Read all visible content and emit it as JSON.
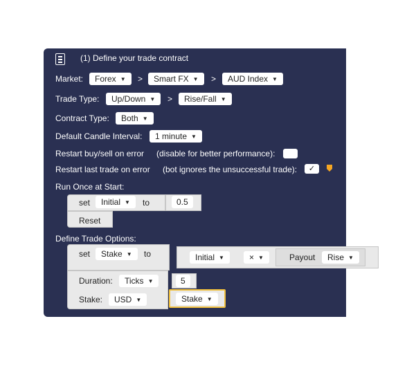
{
  "block": {
    "title": "(1) Define your trade contract",
    "market_label": "Market:",
    "market": "Forex",
    "submarket": "Smart FX",
    "symbol": "AUD Index",
    "sep1": ">",
    "sep2": ">",
    "trade_type_label": "Trade Type:",
    "trade_category": "Up/Down",
    "trade_sep": ">",
    "trade_type": "Rise/Fall",
    "contract_type_label": "Contract Type:",
    "contract_type": "Both",
    "candle_interval_label": "Default Candle Interval:",
    "candle_interval": "1 minute",
    "restart_error_label": "Restart buy/sell on error",
    "restart_error_hint": "(disable for better performance):",
    "restart_error_checked": false,
    "restart_last_label": "Restart last trade on error",
    "restart_last_hint": "(bot ignores the unsuccessful trade):",
    "restart_last_checked": "✓",
    "run_once_label": "Run Once at Start:",
    "trade_options_label": "Define Trade Options:"
  },
  "run_once": {
    "set_label": "set",
    "variable": "Initial",
    "to_label": "to",
    "value": "0.5",
    "reset_label": "Reset"
  },
  "trade_options": {
    "set_label": "set",
    "variable": "Stake",
    "to_label": "to",
    "left_operand": "Initial",
    "operator": "×",
    "payout_label": "Payout",
    "payout_type": "Rise",
    "duration_label": "Duration:",
    "duration_unit": "Ticks",
    "duration_value": "5",
    "stake_label": "Stake:",
    "currency": "USD",
    "stake_variable": "Stake"
  },
  "colors": {
    "block_bg": "#2a3052",
    "sub_block_bg": "#e9e9e9",
    "highlight": "#f2c13d",
    "warning": "#f5a623"
  }
}
